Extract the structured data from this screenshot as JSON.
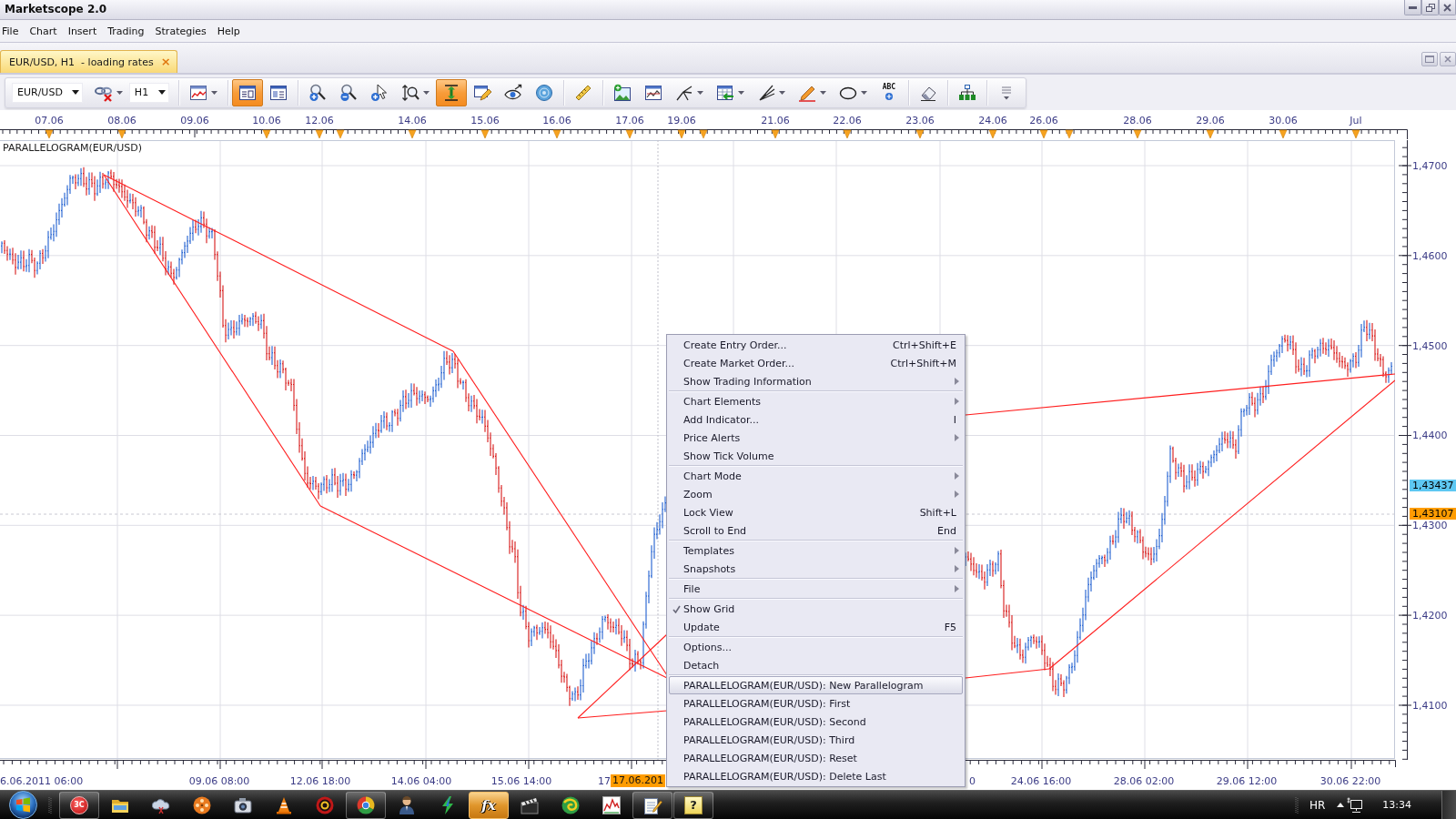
{
  "window": {
    "title": "Marketscope 2.0"
  },
  "menu_bar": [
    "File",
    "Chart",
    "Insert",
    "Trading",
    "Strategies",
    "Help"
  ],
  "document_tabs": [
    {
      "label": "EUR/USD, H1  - loading rates",
      "close": "×",
      "selected": true
    }
  ],
  "toolbar": [
    {
      "kind": "select",
      "value": "EUR/USD"
    },
    {
      "kind": "tool",
      "on": false,
      "has_menu": true
    },
    {
      "kind": "select",
      "value": "H1"
    },
    {
      "kind": "separator"
    },
    {
      "kind": "tool",
      "on": false,
      "has_menu": true
    },
    {
      "kind": "separator"
    },
    {
      "kind": "tool",
      "on": true,
      "has_menu": false
    },
    {
      "kind": "tool",
      "on": false,
      "has_menu": false
    },
    {
      "kind": "separator"
    },
    {
      "kind": "tool",
      "on": false,
      "has_menu": false
    },
    {
      "kind": "tool",
      "on": false,
      "has_menu": false
    },
    {
      "kind": "tool",
      "on": false,
      "has_menu": false
    },
    {
      "kind": "tool",
      "on": false,
      "has_menu": true
    },
    {
      "kind": "tool",
      "on": true,
      "has_menu": false
    },
    {
      "kind": "tool",
      "on": false,
      "has_menu": false
    },
    {
      "kind": "tool",
      "on": false,
      "has_menu": false
    },
    {
      "kind": "tool",
      "on": false,
      "has_menu": false
    },
    {
      "kind": "separator"
    },
    {
      "kind": "tool",
      "on": false,
      "has_menu": false
    },
    {
      "kind": "separator"
    },
    {
      "kind": "tool",
      "on": false,
      "has_menu": false
    },
    {
      "kind": "tool",
      "on": false,
      "has_menu": false
    },
    {
      "kind": "tool",
      "on": false,
      "has_menu": true
    },
    {
      "kind": "tool",
      "on": false,
      "has_menu": true
    },
    {
      "kind": "tool",
      "on": false,
      "has_menu": true
    },
    {
      "kind": "tool",
      "on": false,
      "has_menu": true
    },
    {
      "kind": "tool",
      "on": false,
      "has_menu": true
    },
    {
      "kind": "tool",
      "on": false,
      "has_menu": false,
      "glyph": "ABC"
    },
    {
      "kind": "separator"
    },
    {
      "kind": "tool",
      "on": false,
      "has_menu": false
    },
    {
      "kind": "separator"
    },
    {
      "kind": "tool",
      "on": false,
      "has_menu": false
    },
    {
      "kind": "separator"
    },
    {
      "kind": "tool",
      "on": false,
      "has_menu": false
    }
  ],
  "chart": {
    "indicator_label": "PARALLELOGRAM(EUR/USD)",
    "top_time_labels": [
      "07.06",
      "08.06",
      "09.06",
      "10.06",
      "12.06",
      "14.06",
      "15.06",
      "16.06",
      "17.06",
      "19.06",
      "21.06",
      "22.06",
      "23.06",
      "24.06",
      "26.06",
      "28.06",
      "29.06",
      "30.06",
      "Jul"
    ],
    "price_labels": [
      "1,4700",
      "1,4600",
      "1,4500",
      "1,4400",
      "1,4300",
      "1,4200",
      "1,4100"
    ],
    "price_tags": [
      {
        "text": "1,43437",
        "color": "#5ec8f2"
      },
      {
        "text": "1,43107",
        "color": "#ff9c00"
      }
    ],
    "bottom_time_labels": [
      "6.06.2011 06:00",
      "09.06 08:00",
      "12.06 18:00",
      "14.06 04:00",
      "15.06 14:00",
      "17",
      "0",
      "24.06 16:00",
      "28.06 02:00",
      "29.06 12:00",
      "30.06 22:00"
    ],
    "cursor_time_tag": "17.06.201"
  },
  "context_menu": {
    "groups": [
      {
        "items": [
          {
            "label": "Create Entry Order...",
            "shortcut": "Ctrl+Shift+E",
            "submenu": false,
            "checked": false,
            "selected": false
          },
          {
            "label": "Create Market Order...",
            "shortcut": "Ctrl+Shift+M",
            "submenu": false,
            "checked": false,
            "selected": false
          },
          {
            "label": "Show Trading Information",
            "submenu": true,
            "checked": false,
            "selected": false
          }
        ]
      },
      {
        "items": [
          {
            "label": "Chart Elements",
            "submenu": true,
            "checked": false,
            "selected": false
          },
          {
            "label": "Add Indicator...",
            "shortcut": "I",
            "submenu": false,
            "checked": false,
            "selected": false
          },
          {
            "label": "Price Alerts",
            "submenu": true,
            "checked": false,
            "selected": false
          },
          {
            "label": "Show Tick Volume",
            "submenu": false,
            "checked": false,
            "selected": false
          }
        ]
      },
      {
        "items": [
          {
            "label": "Chart Mode",
            "submenu": true,
            "checked": false,
            "selected": false
          },
          {
            "label": "Zoom",
            "submenu": true,
            "checked": false,
            "selected": false
          },
          {
            "label": "Lock View",
            "shortcut": "Shift+L",
            "submenu": false,
            "checked": false,
            "selected": false
          },
          {
            "label": "Scroll to End",
            "shortcut": "End",
            "submenu": false,
            "checked": false,
            "selected": false
          }
        ]
      },
      {
        "items": [
          {
            "label": "Templates",
            "submenu": true,
            "checked": false,
            "selected": false
          },
          {
            "label": "Snapshots",
            "submenu": true,
            "checked": false,
            "selected": false
          }
        ]
      },
      {
        "items": [
          {
            "label": "File",
            "submenu": true,
            "checked": false,
            "selected": false
          }
        ]
      },
      {
        "items": [
          {
            "label": "Show Grid",
            "submenu": false,
            "checked": true,
            "selected": false
          },
          {
            "label": "Update",
            "shortcut": "F5",
            "submenu": false,
            "checked": false,
            "selected": false
          }
        ]
      },
      {
        "items": [
          {
            "label": "Options...",
            "submenu": false,
            "checked": false,
            "selected": false
          },
          {
            "label": "Detach",
            "submenu": false,
            "checked": false,
            "selected": false
          }
        ]
      },
      {
        "items": [
          {
            "label": "PARALLELOGRAM(EUR/USD): New Parallelogram",
            "submenu": false,
            "checked": false,
            "selected": true
          },
          {
            "label": "PARALLELOGRAM(EUR/USD): First",
            "submenu": false,
            "checked": false,
            "selected": false
          },
          {
            "label": "PARALLELOGRAM(EUR/USD): Second",
            "submenu": false,
            "checked": false,
            "selected": false
          },
          {
            "label": "PARALLELOGRAM(EUR/USD): Third",
            "submenu": false,
            "checked": false,
            "selected": false
          },
          {
            "label": "PARALLELOGRAM(EUR/USD): Reset",
            "submenu": false,
            "checked": false,
            "selected": false
          },
          {
            "label": "PARALLELOGRAM(EUR/USD): Delete Last",
            "submenu": false,
            "checked": false,
            "selected": false
          }
        ]
      }
    ]
  },
  "taskbar": {
    "apps": [
      {
        "open": true,
        "selected": false,
        "glyph": "3C"
      },
      {
        "open": false,
        "selected": false
      },
      {
        "open": false,
        "selected": false
      },
      {
        "open": false,
        "selected": false
      },
      {
        "open": false,
        "selected": false
      },
      {
        "open": false,
        "selected": false
      },
      {
        "open": false,
        "selected": false
      },
      {
        "open": true,
        "selected": false
      },
      {
        "open": false,
        "selected": false
      },
      {
        "open": false,
        "selected": false
      },
      {
        "open": true,
        "selected": true,
        "glyph": "fx"
      },
      {
        "open": false,
        "selected": false
      },
      {
        "open": false,
        "selected": false
      },
      {
        "open": false,
        "selected": false
      },
      {
        "open": true,
        "selected": false
      },
      {
        "open": true,
        "selected": false,
        "glyph": "?"
      }
    ],
    "language": "HR",
    "clock": "13:34"
  }
}
